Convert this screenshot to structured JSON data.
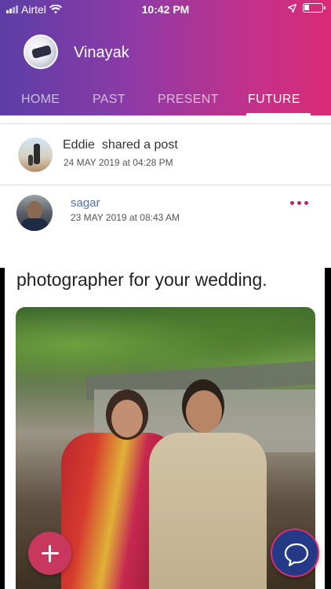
{
  "status_bar": {
    "carrier": "Airtel",
    "time": "10:42 PM",
    "battery_level": 0.3
  },
  "header": {
    "profile_name": "Vinayak",
    "avatar_icon": "soccer-ball-avatar",
    "gradient_colors": [
      "#5b3ea6",
      "#d92a77"
    ]
  },
  "tabs": [
    {
      "label": "HOME",
      "active": false
    },
    {
      "label": "PAST",
      "active": false
    },
    {
      "label": "PRESENT",
      "active": false
    },
    {
      "label": "FUTURE",
      "active": true
    }
  ],
  "feed": {
    "share_item": {
      "user": "Eddie",
      "action": "shared a post",
      "timestamp": "24 MAY 2019 at 04:28 PM"
    },
    "original_post": {
      "user": "sagar",
      "timestamp": "23 MAY 2019 at 08:43 AM",
      "caption": "photographer for your wedding."
    }
  },
  "actions": {
    "add_icon": "plus-icon",
    "chat_icon": "chat-bubble-icon",
    "more_icon": "more-dots-icon",
    "accent_color": "#c8385e"
  }
}
